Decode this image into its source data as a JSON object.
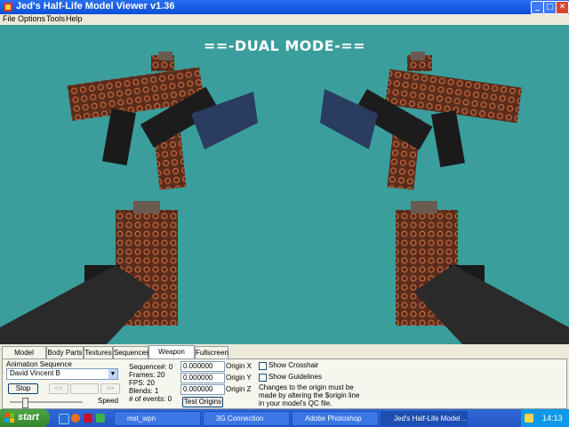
{
  "window": {
    "title": "Jed's Half-Life Model Viewer v1.36"
  },
  "menu": [
    "File",
    "Options",
    "Tools",
    "Help"
  ],
  "viewport": {
    "banner": "==-DUAL MODE-==",
    "background": "#3a9e9c"
  },
  "tabs": [
    "Model Display",
    "Body Parts",
    "Textures",
    "Sequences",
    "Weapon Origin",
    "Fullscreen"
  ],
  "active_tab": "Weapon Origin",
  "animation": {
    "label": "Animation Sequence",
    "selected": "David Vincent B",
    "stop_label": "Stop",
    "prev_label": "<<",
    "next_label": ">>",
    "speed_label": "Speed"
  },
  "sequence_info": {
    "sequence": "Sequence#: 0",
    "frames": "Frames: 20",
    "fps": "FPS: 20",
    "blends": "Blends: 1",
    "events": "# of events: 0"
  },
  "origin": {
    "x_value": "0.000000",
    "y_value": "0.000000",
    "z_value": "0.000000",
    "x_label": "Origin X",
    "y_label": "Origin Y",
    "z_label": "Origin Z",
    "test_label": "Test Origins"
  },
  "options": {
    "crosshair": "Show Crosshair",
    "guidelines": "Show Guidelines",
    "note_line1": "Changes to the origin must be",
    "note_line2": "made by altering the $origin line",
    "note_line3": "in your model's QC file."
  },
  "taskbar": {
    "start": "start",
    "tasks": [
      "mst_wpn",
      "3G Connection",
      "Adobe Photoshop",
      "Jed's Half-Life Model ..."
    ],
    "clock": "14:13"
  }
}
